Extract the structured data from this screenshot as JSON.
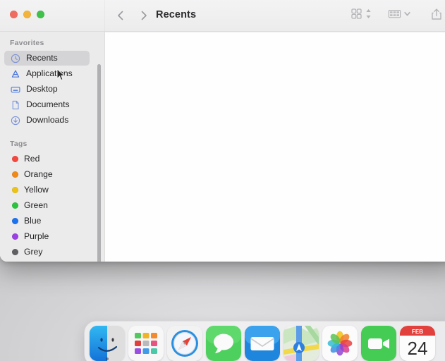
{
  "window": {
    "title": "Recents",
    "traffic_lights": [
      {
        "name": "close",
        "color": "#ef6d60"
      },
      {
        "name": "minimize",
        "color": "#f2b43c"
      },
      {
        "name": "zoom",
        "color": "#3fc14a"
      }
    ],
    "nav": {
      "back_icon": "chevron-left-icon",
      "forward_icon": "chevron-right-icon"
    },
    "toolbar_right": [
      {
        "name": "view-as-icons-button",
        "icon": "grid-view-icon",
        "has_stepper": true
      },
      {
        "name": "group-by-button",
        "icon": "group-view-icon",
        "has_chevron": true
      },
      {
        "name": "share-button",
        "icon": "share-icon"
      }
    ]
  },
  "sidebar": {
    "sections": [
      {
        "header": "Favorites",
        "items": [
          {
            "label": "Recents",
            "icon": "clock-icon",
            "selected": true
          },
          {
            "label": "Applications",
            "icon": "applications-icon",
            "selected": false
          },
          {
            "label": "Desktop",
            "icon": "desktop-icon",
            "selected": false
          },
          {
            "label": "Documents",
            "icon": "document-icon",
            "selected": false
          },
          {
            "label": "Downloads",
            "icon": "download-icon",
            "selected": false
          }
        ]
      },
      {
        "header": "Tags",
        "items": [
          {
            "label": "Red",
            "icon": "tag-dot-icon",
            "color": "#f5473e"
          },
          {
            "label": "Orange",
            "icon": "tag-dot-icon",
            "color": "#ef8a19"
          },
          {
            "label": "Yellow",
            "icon": "tag-dot-icon",
            "color": "#edc313"
          },
          {
            "label": "Green",
            "icon": "tag-dot-icon",
            "color": "#28c53c"
          },
          {
            "label": "Blue",
            "icon": "tag-dot-icon",
            "color": "#1a72f0"
          },
          {
            "label": "Purple",
            "icon": "tag-dot-icon",
            "color": "#9a41e3"
          },
          {
            "label": "Grey",
            "icon": "tag-dot-icon",
            "color": "#606063"
          }
        ]
      }
    ]
  },
  "content": {
    "items": [],
    "empty": ""
  },
  "dock": {
    "items": [
      {
        "label": "Finder",
        "icon": "finder-icon",
        "running": true
      },
      {
        "label": "Launchpad",
        "icon": "launchpad-icon",
        "running": false
      },
      {
        "label": "Safari",
        "icon": "safari-icon",
        "running": false
      },
      {
        "label": "Messages",
        "icon": "messages-icon",
        "running": false
      },
      {
        "label": "Mail",
        "icon": "mail-icon",
        "running": false
      },
      {
        "label": "Maps",
        "icon": "maps-icon",
        "running": false
      },
      {
        "label": "Photos",
        "icon": "photos-icon",
        "running": false
      },
      {
        "label": "FaceTime",
        "icon": "facetime-icon",
        "running": false
      },
      {
        "label": "Calendar",
        "icon": "calendar-icon",
        "running": false,
        "month": "FEB",
        "day": "24"
      }
    ]
  }
}
